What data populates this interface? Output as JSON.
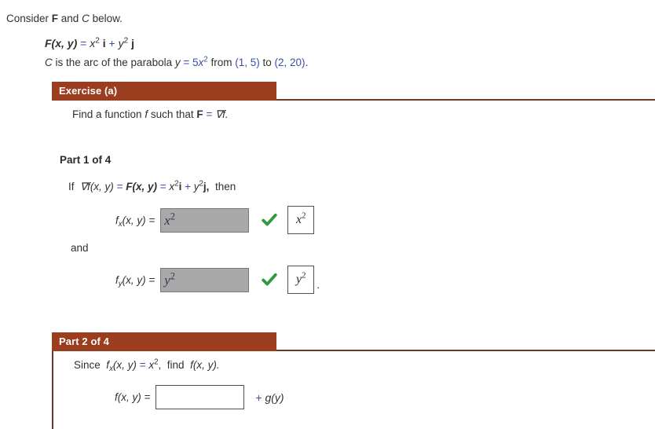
{
  "document": {
    "intro": "Consider F and C below.",
    "vector_field": {
      "lhs": "F(x, y)",
      "equals": "=",
      "term1_base": "x",
      "term1_exp": "2",
      "term1_unit": "i",
      "plus": "+",
      "term2_base": "y",
      "term2_exp": "2",
      "term2_unit": "j"
    },
    "curve_description": {
      "prefix": "C is the arc of the parabola",
      "var": "y",
      "equals": "=",
      "coef": "5",
      "base": "x",
      "exp": "2",
      "from_word": "from",
      "point1": "(1, 5)",
      "to_word": "to",
      "point2": "(2, 20)",
      "period": "."
    }
  },
  "exercise": {
    "header": "Exercise (a)",
    "prompt_prefix": "Find a function",
    "prompt_f": "f",
    "prompt_mid": "such that",
    "prompt_F": "F",
    "prompt_eq": "=",
    "prompt_grad": "∇f."
  },
  "part1": {
    "label": "Part 1 of 4",
    "if_line": {
      "if": "If",
      "grad_f": "∇f(x, y)",
      "eq1": "=",
      "F": "F(x, y)",
      "eq2": "=",
      "t1_base": "x",
      "t1_exp": "2",
      "t1_unit": "i",
      "plus": "+",
      "t2_base": "y",
      "t2_exp": "2",
      "t2_unit": "j,",
      "then": "then"
    },
    "and_word": "and",
    "rows": [
      {
        "name": "fx",
        "label_base": "f",
        "label_sub": "x",
        "label_tail": "(x, y)  =",
        "input_value_base": "x",
        "input_value_exp": "2",
        "status": "correct",
        "status_icon": "green-check-icon",
        "answer_base": "x",
        "answer_exp": "2",
        "trailing": ""
      },
      {
        "name": "fy",
        "label_base": "f",
        "label_sub": "y",
        "label_tail": "(x, y)  =",
        "input_value_base": "y",
        "input_value_exp": "2",
        "status": "correct",
        "status_icon": "green-check-icon",
        "answer_base": "y",
        "answer_exp": "2",
        "trailing": "."
      }
    ]
  },
  "part2": {
    "header": "Part 2 of 4",
    "since_line": {
      "since": "Since",
      "fx_base": "f",
      "fx_sub": "x",
      "fx_tail": "(x, y)",
      "eq": "=",
      "rhs_base": "x",
      "rhs_exp": "2",
      "comma": ",",
      "find": "find",
      "target": "f(x, y)."
    },
    "row": {
      "label": "f(x, y)  =",
      "input_value": "",
      "input_placeholder": "",
      "trailing": "+ g(y)"
    }
  },
  "colors": {
    "header_bar": "#9b3d1f",
    "rule": "#6b3b28",
    "text": "#33302b",
    "accent_number": "#3b4fa3",
    "check_green": "#2f9a3e",
    "disabled_field": "#a9a9a9"
  }
}
